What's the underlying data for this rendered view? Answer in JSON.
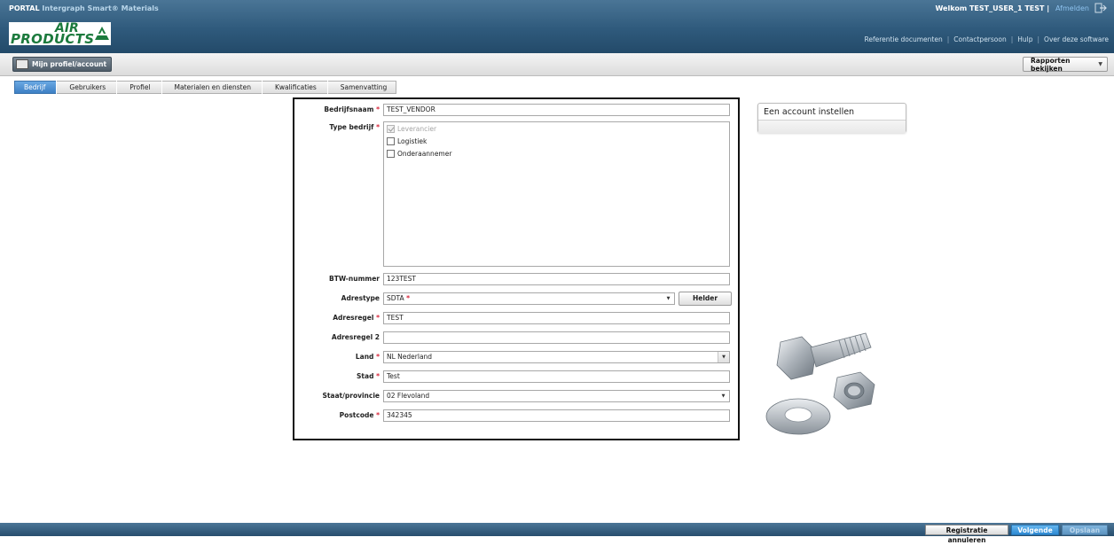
{
  "header": {
    "portal": "PORTAL",
    "product": "Intergraph Smart® Materials",
    "logo_text_air": "AIR",
    "logo_text_products": "PRODUCTS",
    "welcome": "Welkom TEST_USER_1 TEST",
    "separator": "|",
    "logout": "Afmelden",
    "links": [
      "Referentie documenten",
      "Contactpersoon",
      "Hulp",
      "Over deze software"
    ]
  },
  "toolbar": {
    "profile_button": "Mijn profiel/account",
    "reports_button": "Rapporten bekijken"
  },
  "tabs": [
    "Bedrijf",
    "Gebruikers",
    "Profiel",
    "Materialen en diensten",
    "Kwalificaties",
    "Samenvatting"
  ],
  "active_tab": "Bedrijf",
  "form": {
    "company_name": {
      "label": "Bedrijfsnaam",
      "value": "TEST_VENDOR",
      "required": true
    },
    "company_type": {
      "label": "Type bedrijf",
      "required": true,
      "options": [
        {
          "label": "Leverancier",
          "checked": true,
          "disabled": true
        },
        {
          "label": "Logistiek",
          "checked": false,
          "disabled": false
        },
        {
          "label": "Onderaannemer",
          "checked": false,
          "disabled": false
        }
      ]
    },
    "vat": {
      "label": "BTW-nummer",
      "value": "123TEST"
    },
    "address_type": {
      "label": "Adrestype",
      "value": "SDTA",
      "value_marker": "*",
      "clear_button": "Helder"
    },
    "address_line": {
      "label": "Adresregel",
      "value": "TEST",
      "required": true
    },
    "address_line2": {
      "label": "Adresregel 2",
      "value": ""
    },
    "country": {
      "label": "Land",
      "value": "NL  Nederland",
      "required": true
    },
    "city": {
      "label": "Stad",
      "value": "Test",
      "required": true
    },
    "state": {
      "label": "Staat/provincie",
      "value": "02  Flevoland"
    },
    "postcode": {
      "label": "Postcode",
      "value": "342345",
      "required": true
    },
    "required_marker": "*"
  },
  "side_card": {
    "title": "Een account instellen"
  },
  "footer": {
    "cancel": "Registratie annuleren",
    "next": "Volgende",
    "save": "Opslaan"
  },
  "colors": {
    "header_blue": "#2f5a7c",
    "active_tab": "#3d7fc4",
    "required": "#d8263a",
    "logo_green": "#1c7a3d"
  },
  "icons": [
    "home-icon",
    "logout-icon",
    "dropdown-caret-icon",
    "bolt-nut-washer-image"
  ]
}
